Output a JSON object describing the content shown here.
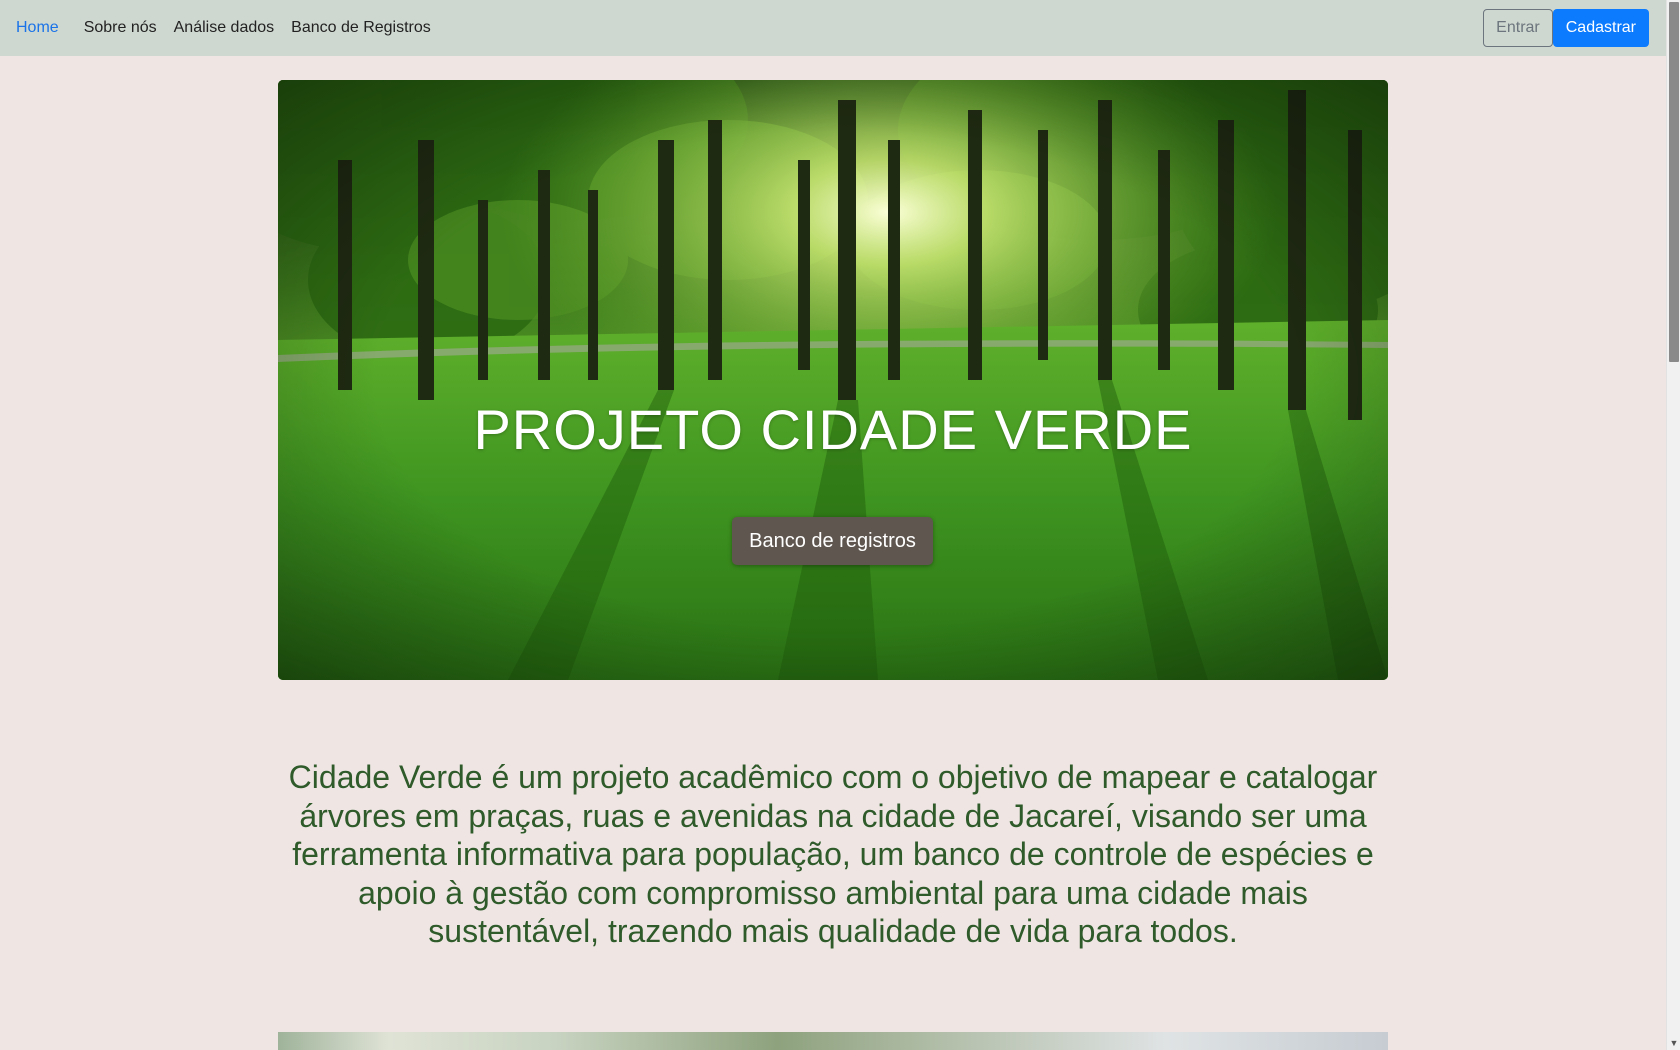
{
  "navbar": {
    "links": [
      {
        "label": "Home",
        "active": true
      },
      {
        "label": "Sobre nós"
      },
      {
        "label": "Análise dados"
      },
      {
        "label": "Banco de Registros"
      }
    ],
    "login_label": "Entrar",
    "signup_label": "Cadastrar"
  },
  "hero": {
    "title": "PROJETO CIDADE VERDE",
    "button_label": "Banco de registros"
  },
  "description": "Cidade Verde é um projeto acadêmico com o objetivo de mapear e catalogar árvores em praças, ruas e avenidas na cidade de Jacareí, visando ser uma ferramenta informativa para população, um banco de controle de espécies e apoio à gestão com compromisso ambiental para uma cidade mais sustentável, trazendo mais qualidade de vida para todos.",
  "colors": {
    "navbar_bg": "#cfd8d0",
    "page_bg": "#efe6e4",
    "accent_blue": "#0d7bfd",
    "description_text": "#2f5a2a",
    "hero_button_bg": "#5f564f"
  }
}
